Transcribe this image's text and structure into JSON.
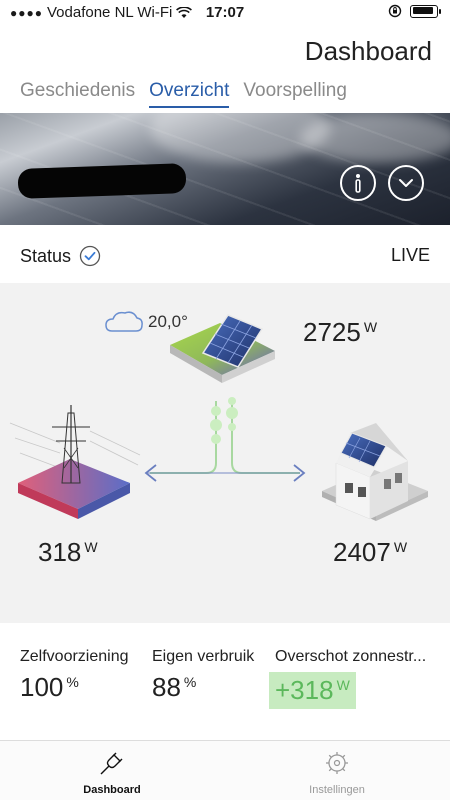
{
  "statusbar": {
    "carrier": "Vodafone NL Wi-Fi",
    "time": "17:07",
    "battery_level": 0.9
  },
  "header": {
    "title": "Dashboard",
    "tabs": [
      {
        "label": "Geschiedenis",
        "active": false
      },
      {
        "label": "Overzicht",
        "active": true
      },
      {
        "label": "Voorspelling",
        "active": false
      }
    ]
  },
  "status": {
    "label": "Status",
    "live": "LIVE"
  },
  "flow": {
    "weather": {
      "icon": "cloud-icon",
      "temperature": "20,0°"
    },
    "solar": {
      "value": "2725",
      "unit": "W"
    },
    "grid": {
      "value": "318",
      "unit": "W"
    },
    "home": {
      "value": "2407",
      "unit": "W"
    }
  },
  "stats": [
    {
      "label": "Zelfvoorziening",
      "value": "100",
      "unit": "%"
    },
    {
      "label": "Eigen verbruik",
      "value": "88",
      "unit": "%"
    },
    {
      "label": "Overschot zonnestr...",
      "value": "+318",
      "unit": "W"
    }
  ],
  "nav": {
    "dashboard": "Dashboard",
    "settings": "Instellingen"
  },
  "colors": {
    "accent": "#2a5da8",
    "surplus_bg": "#c7ebc0",
    "surplus_text": "#5cb85c",
    "status_check": "#3a7bd5"
  }
}
